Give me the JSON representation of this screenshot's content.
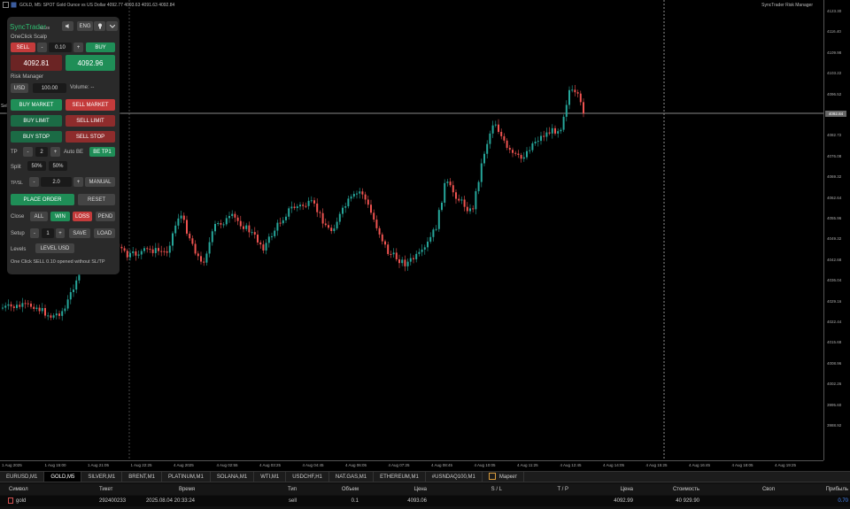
{
  "window": {
    "symbol_line": "GOLD, M5:  SPOT Gold Ounce vs US Dollar  4092.77 4093.63 4091.63 4092.84",
    "indicator_name": "SyncTrader Risk Manager"
  },
  "y_axis": {
    "ticks": [
      "4123.30",
      "4116.40",
      "4109.98",
      "4103.22",
      "4096.52",
      "4089.84",
      "4082.72",
      "4076.08",
      "4069.32",
      "4062.64",
      "4055.96",
      "4049.32",
      "4042.68",
      "4036.04",
      "4029.16",
      "4022.44",
      "4015.68",
      "4008.96",
      "4002.26",
      "3995.60",
      "3988.92"
    ],
    "current_price": "4092.84"
  },
  "x_axis": {
    "ticks": [
      "1 Aug 2025",
      "1 Aug 15:00",
      "1 Aug 21:05",
      "1 Aug 22:25",
      "4 Aug 2025",
      "4 Aug 02:55",
      "4 Aug 03:25",
      "4 Aug 04:45",
      "4 Aug 06:05",
      "4 Aug 07:25",
      "4 Aug 08:45",
      "4 Aug 10:05",
      "4 Aug 11:25",
      "4 Aug 12:45",
      "4 Aug 14:05",
      "4 Aug 15:25",
      "4 Aug 16:45",
      "4 Aug 18:05",
      "4 Aug 19:25"
    ]
  },
  "panel": {
    "title": "SyncTrader",
    "version": "v1.28",
    "eng_label": "ENG",
    "oneclick_label": "OneClick Scalp",
    "sell_label": "SELL",
    "minus": "-",
    "plus": "+",
    "lot_value": "0.10",
    "buy_label": "BUY",
    "bid_price": "4092.81",
    "ask_price": "4092.96",
    "risk_label": "Risk Manager",
    "usd_label": "USD",
    "risk_value": "100.00",
    "volume_label": "Volume: --",
    "buy_market": "BUY MARKET",
    "sell_market": "SELL MARKET",
    "buy_limit": "BUY LIMIT",
    "sell_limit": "SELL LIMIT",
    "buy_stop": "BUY STOP",
    "sell_stop": "SELL STOP",
    "tp_label": "TP",
    "tp_value": "2",
    "auto_be_label": "Auto BE",
    "be_tp1": "BE TP1",
    "split_label": "Split",
    "split1": "50%",
    "split2": "50%",
    "tpsl_label": "TP/SL",
    "tpsl_value": "2.0",
    "manual_label": "MANUAL",
    "place_order": "PLACE ORDER",
    "reset": "RESET",
    "close_label": "Close",
    "all": "ALL",
    "win": "WIN",
    "loss": "LOSS",
    "pend": "PEND",
    "setup_label": "Setup",
    "setup_value": "1",
    "save": "SAVE",
    "load": "LOAD",
    "levels_label": "Levels",
    "level_usd": "LEVEL USD",
    "status": "One Click SELL 0.10 opened without SL/TP"
  },
  "side_label": "Sell",
  "tabs": [
    "EURUSD,M1",
    "GOLD,M5",
    "SILVER,M1",
    "BRENT,M1",
    "PLATINUM,M1",
    "SOLANA,M1",
    "WTI,M1",
    "USDCHF,H1",
    "NAT.GAS,M1",
    "ETHEREUM,M1",
    "#USNDAQ100,M1",
    "Маркет"
  ],
  "active_tab": "GOLD,M5",
  "terminal": {
    "headers": [
      "Символ",
      "Тикет",
      "Время",
      "Тип",
      "Объем",
      "Цена",
      "S / L",
      "T / P",
      "Цена",
      "Стоимость",
      "Своп",
      "Прибыль"
    ],
    "row": [
      "gold",
      "292400233",
      "2025.08.04 20:33:24",
      "sell",
      "0.1",
      "4093.06",
      "",
      "",
      "4092.99",
      "40 929.90",
      "",
      "0.70"
    ]
  },
  "colors": {
    "bull": "#26a69a",
    "bear": "#ef5350",
    "accent_green": "#1f8e57",
    "accent_red": "#c43b3b"
  }
}
